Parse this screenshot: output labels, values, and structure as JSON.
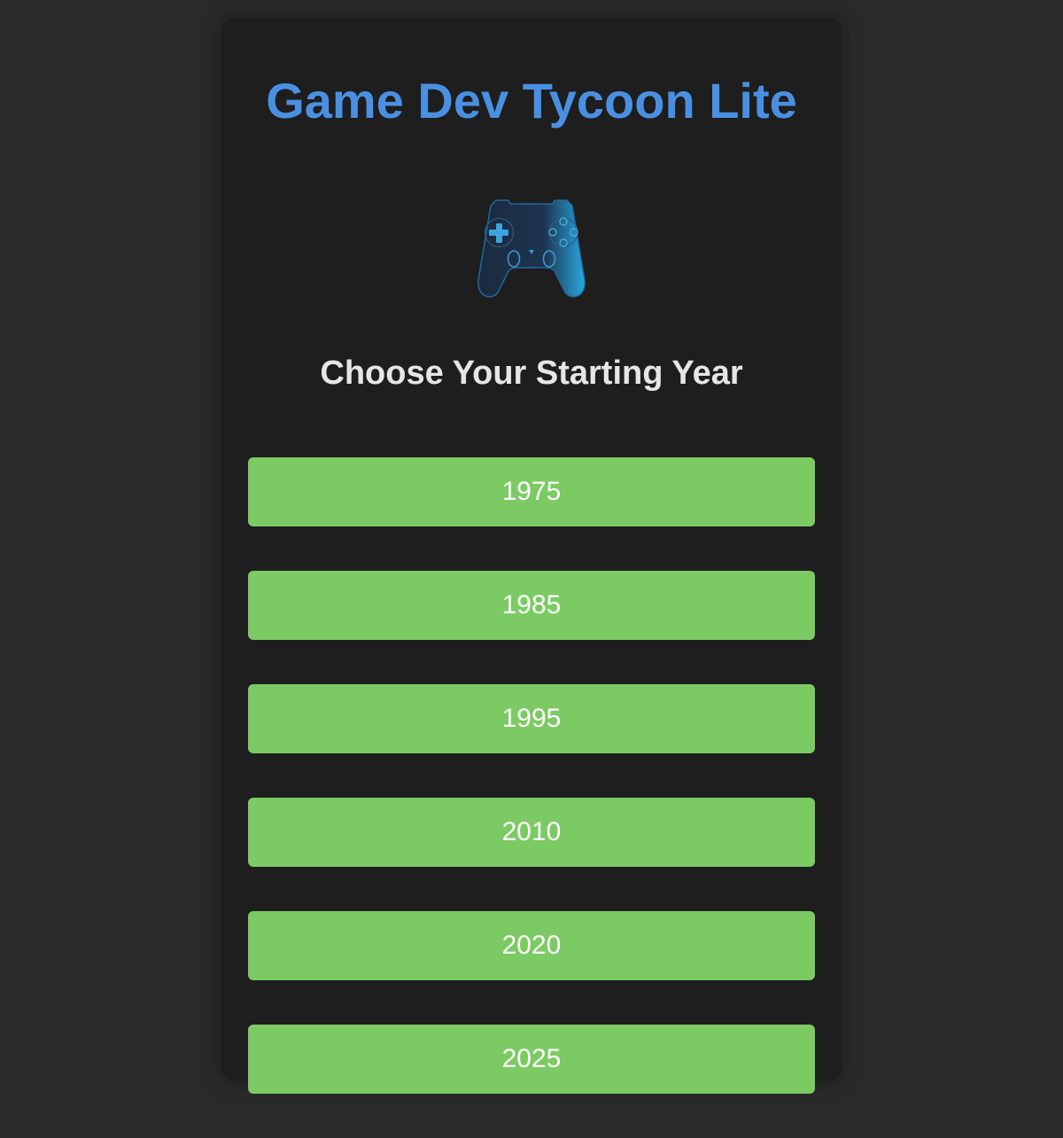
{
  "game": {
    "title": "Game Dev Tycoon Lite",
    "icon": "gamepad-icon",
    "subtitle": "Choose Your Starting Year"
  },
  "years": [
    "1975",
    "1985",
    "1995",
    "2010",
    "2020",
    "2025"
  ],
  "colors": {
    "background": "#2a2a2a",
    "panel": "#1e1e1e",
    "title": "#4a90e2",
    "subtitle": "#e6e6e6",
    "button": "#7cca63",
    "button_text": "#ffffff"
  }
}
